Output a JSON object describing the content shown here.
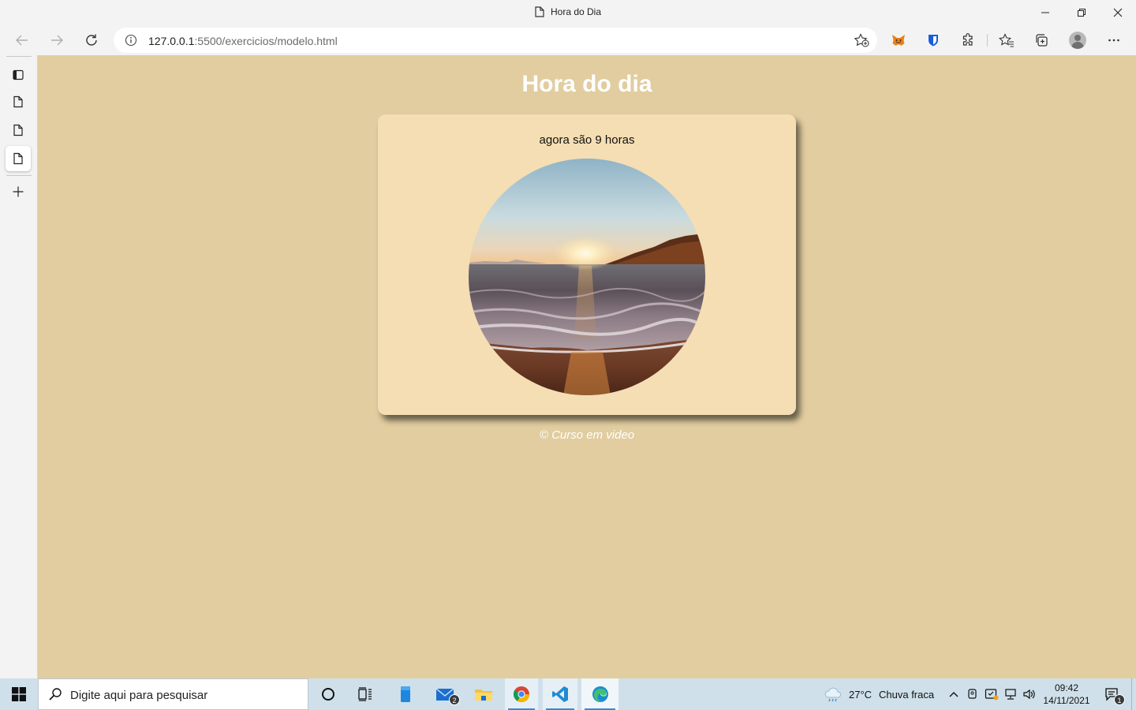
{
  "window": {
    "title": "Hora do Dia",
    "minimize_glyph": "minimize-icon",
    "maximize_glyph": "restore-icon",
    "close_glyph": "close-icon"
  },
  "toolbar": {
    "url_host": "127.0.0.1",
    "url_rest": ":5500/exercicios/modelo.html",
    "icons": [
      "back-icon",
      "forward-icon",
      "refresh-icon",
      "info-icon",
      "add-favorite-icon",
      "metamask-extension-icon",
      "bitwarden-extension-icon",
      "extensions-icon",
      "favorites-icon",
      "collections-icon",
      "profile-avatar",
      "more-options-icon"
    ]
  },
  "sidebar": {
    "tabs": [
      {
        "name": "tab-actions-icon"
      },
      {
        "name": "tab-page-icon"
      },
      {
        "name": "tab-page-icon"
      },
      {
        "name": "tab-page-icon",
        "active": true
      }
    ],
    "new_tab_icon": "plus-icon"
  },
  "page": {
    "background": "#e1cd9f",
    "card_background": "#f5deb3",
    "title": "Hora do dia",
    "message": "agora são 9 horas",
    "image_alt": "sunrise-beach-photo",
    "footer": "© Curso em video"
  },
  "taskbar": {
    "search_placeholder": "Digite aqui para pesquisar",
    "apps": [
      "windows-start-icon",
      "cortana-icon",
      "task-view-icon",
      "file-app-icon",
      "mail-icon",
      "file-explorer-icon",
      "chrome-icon",
      "vscode-icon",
      "edge-icon"
    ],
    "mail_badge": "2",
    "weather_temp": "27°C",
    "weather_desc": "Chuva fraca",
    "time": "09:42",
    "date": "14/11/2021",
    "notification_count": "1"
  }
}
